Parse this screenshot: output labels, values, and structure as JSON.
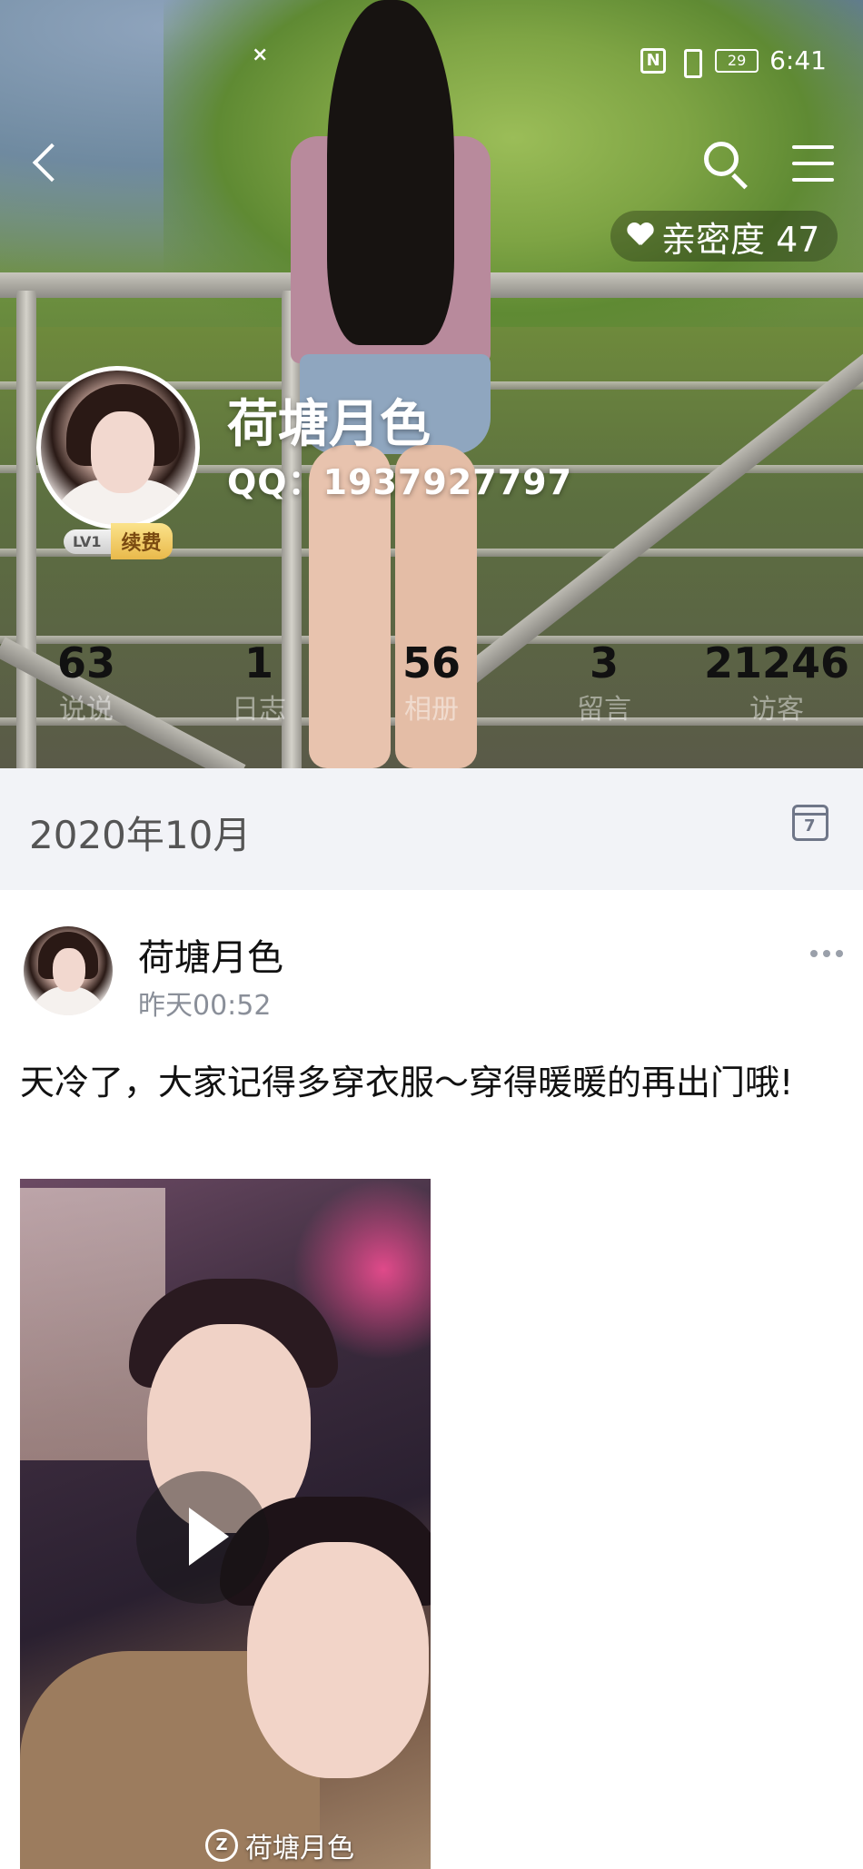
{
  "status_bar": {
    "notification_close": "×",
    "nfc": "N",
    "battery": "29",
    "time": "6:41"
  },
  "header": {
    "intimacy_label": "亲密度 47",
    "nickname": "荷塘月色",
    "qq": "QQ：1937927797",
    "vip_level": "LV1",
    "vip_action": "续费"
  },
  "stats": [
    {
      "value": "63",
      "label": "说说"
    },
    {
      "value": "1",
      "label": "日志"
    },
    {
      "value": "56",
      "label": "相册"
    },
    {
      "value": "3",
      "label": "留言"
    },
    {
      "value": "21246",
      "label": "访客"
    }
  ],
  "date_section": {
    "date": "2020年10月",
    "calendar_day": "7"
  },
  "post": {
    "author": "荷塘月色",
    "time": "昨天00:52",
    "text": "天冷了，大家记得多穿衣服～穿得暖暖的再出门哦!",
    "watermark": "荷塘月色",
    "watermark_icon": "Z"
  },
  "icons": [
    "back-icon",
    "search-icon",
    "menu-icon",
    "heart-icon",
    "calendar-icon",
    "more-icon",
    "play-icon"
  ],
  "colors": {
    "date_bar_bg": "#f2f3f7",
    "secondary_text": "#8a8f99",
    "vip_gold": "#e9b94b"
  }
}
